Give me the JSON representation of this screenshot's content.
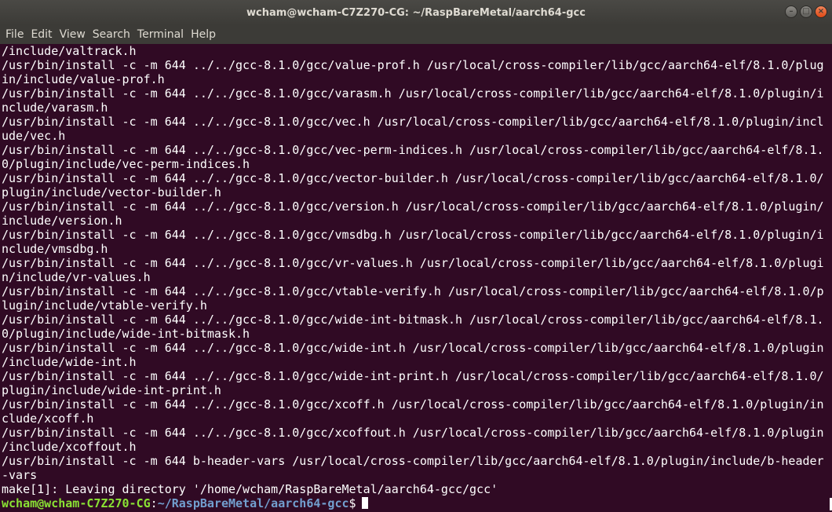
{
  "window": {
    "title": "wcham@wcham-C7Z270-CG: ~/RaspBareMetal/aarch64-gcc",
    "controls": {
      "minimize": "–",
      "maximize": "□",
      "close": "×"
    }
  },
  "menu": {
    "items": [
      "File",
      "Edit",
      "View",
      "Search",
      "Terminal",
      "Help"
    ]
  },
  "terminal": {
    "lines": [
      "/include/valtrack.h",
      "/usr/bin/install -c -m 644 ../../gcc-8.1.0/gcc/value-prof.h /usr/local/cross-compiler/lib/gcc/aarch64-elf/8.1.0/plug",
      "in/include/value-prof.h",
      "/usr/bin/install -c -m 644 ../../gcc-8.1.0/gcc/varasm.h /usr/local/cross-compiler/lib/gcc/aarch64-elf/8.1.0/plugin/i",
      "nclude/varasm.h",
      "/usr/bin/install -c -m 644 ../../gcc-8.1.0/gcc/vec.h /usr/local/cross-compiler/lib/gcc/aarch64-elf/8.1.0/plugin/incl",
      "ude/vec.h",
      "/usr/bin/install -c -m 644 ../../gcc-8.1.0/gcc/vec-perm-indices.h /usr/local/cross-compiler/lib/gcc/aarch64-elf/8.1.",
      "0/plugin/include/vec-perm-indices.h",
      "/usr/bin/install -c -m 644 ../../gcc-8.1.0/gcc/vector-builder.h /usr/local/cross-compiler/lib/gcc/aarch64-elf/8.1.0/",
      "plugin/include/vector-builder.h",
      "/usr/bin/install -c -m 644 ../../gcc-8.1.0/gcc/version.h /usr/local/cross-compiler/lib/gcc/aarch64-elf/8.1.0/plugin/",
      "include/version.h",
      "/usr/bin/install -c -m 644 ../../gcc-8.1.0/gcc/vmsdbg.h /usr/local/cross-compiler/lib/gcc/aarch64-elf/8.1.0/plugin/i",
      "nclude/vmsdbg.h",
      "/usr/bin/install -c -m 644 ../../gcc-8.1.0/gcc/vr-values.h /usr/local/cross-compiler/lib/gcc/aarch64-elf/8.1.0/plugi",
      "n/include/vr-values.h",
      "/usr/bin/install -c -m 644 ../../gcc-8.1.0/gcc/vtable-verify.h /usr/local/cross-compiler/lib/gcc/aarch64-elf/8.1.0/p",
      "lugin/include/vtable-verify.h",
      "/usr/bin/install -c -m 644 ../../gcc-8.1.0/gcc/wide-int-bitmask.h /usr/local/cross-compiler/lib/gcc/aarch64-elf/8.1.",
      "0/plugin/include/wide-int-bitmask.h",
      "/usr/bin/install -c -m 644 ../../gcc-8.1.0/gcc/wide-int.h /usr/local/cross-compiler/lib/gcc/aarch64-elf/8.1.0/plugin",
      "/include/wide-int.h",
      "/usr/bin/install -c -m 644 ../../gcc-8.1.0/gcc/wide-int-print.h /usr/local/cross-compiler/lib/gcc/aarch64-elf/8.1.0/",
      "plugin/include/wide-int-print.h",
      "/usr/bin/install -c -m 644 ../../gcc-8.1.0/gcc/xcoff.h /usr/local/cross-compiler/lib/gcc/aarch64-elf/8.1.0/plugin/in",
      "clude/xcoff.h",
      "/usr/bin/install -c -m 644 ../../gcc-8.1.0/gcc/xcoffout.h /usr/local/cross-compiler/lib/gcc/aarch64-elf/8.1.0/plugin",
      "/include/xcoffout.h",
      "/usr/bin/install -c -m 644 b-header-vars /usr/local/cross-compiler/lib/gcc/aarch64-elf/8.1.0/plugin/include/b-header",
      "-vars",
      "make[1]: Leaving directory '/home/wcham/RaspBareMetal/aarch64-gcc/gcc'"
    ],
    "prompt": {
      "user_host": "wcham@wcham-C7Z270-CG",
      "separator": ":",
      "path": "~/RaspBareMetal/aarch64-gcc",
      "symbol": "$"
    }
  },
  "colors": {
    "terminal_bg": "#300a24",
    "terminal_fg": "#ffffff",
    "prompt_user": "#8ae234",
    "prompt_path": "#729fcf",
    "titlebar_bg": "#3c3b37",
    "close_button": "#df4a16"
  }
}
